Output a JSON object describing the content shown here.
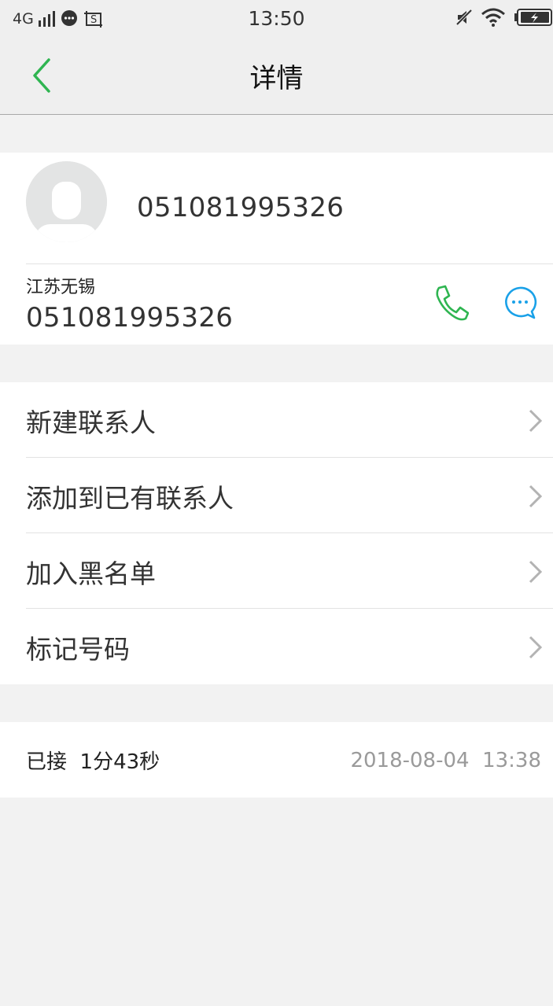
{
  "status_bar": {
    "network": "4G",
    "time": "13:50",
    "icons": [
      "signal-icon",
      "chat-notification-icon",
      "screenshot-icon",
      "mute-icon",
      "wifi-icon",
      "battery-charging-icon"
    ]
  },
  "nav": {
    "title": "详情",
    "back_icon": "chevron-left-icon",
    "accent_color": "#2fb551"
  },
  "contact": {
    "name": "051081995326",
    "location": "江苏无锡",
    "phone": "051081995326",
    "call_icon": "phone-icon",
    "call_color": "#2fb551",
    "message_icon": "message-icon",
    "message_color": "#1aa1e8"
  },
  "menu": {
    "items": [
      {
        "label": "新建联系人"
      },
      {
        "label": "添加到已有联系人"
      },
      {
        "label": "加入黑名单"
      },
      {
        "label": "标记号码"
      }
    ]
  },
  "record": {
    "status": "已接  1分43秒",
    "datetime": "2018-08-04  13:38"
  }
}
